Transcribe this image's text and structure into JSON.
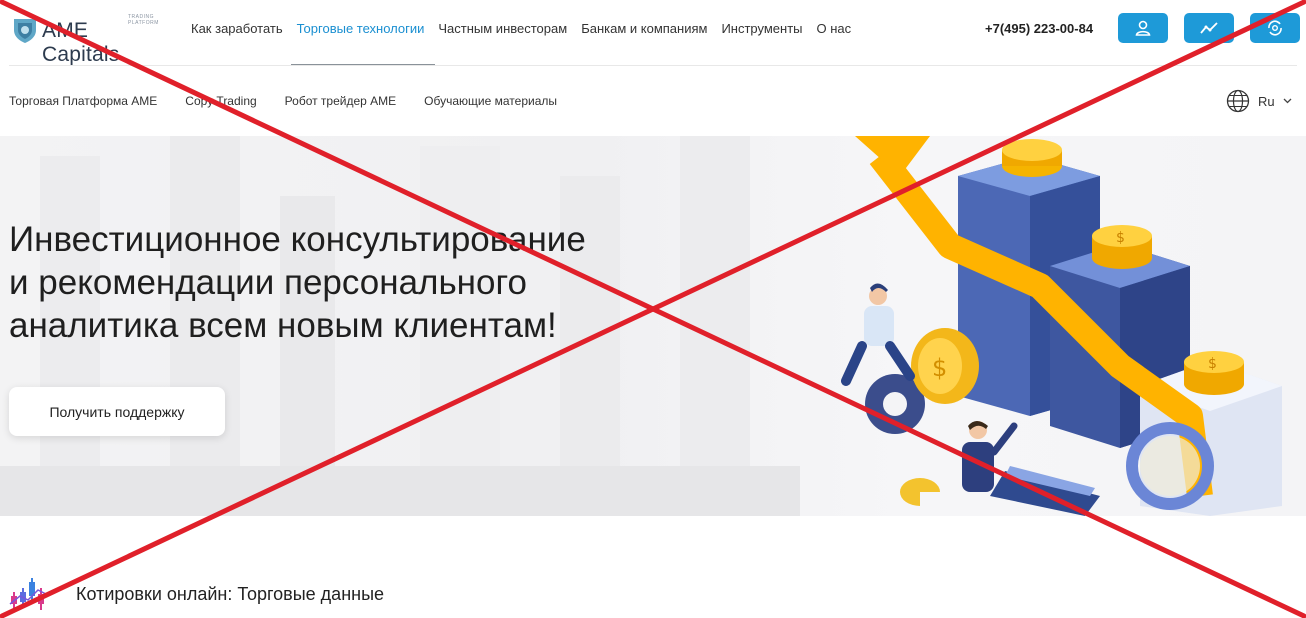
{
  "header": {
    "logo_text": "AME Capitals",
    "logo_subtitle": "TRADING PLATFORM",
    "nav": [
      {
        "label": "Как заработать"
      },
      {
        "label": "Торговые технологии",
        "active": true
      },
      {
        "label": "Частным инвесторам"
      },
      {
        "label": "Банкам и компаниям"
      },
      {
        "label": "Инструменты"
      },
      {
        "label": "О нас"
      }
    ],
    "phone": "+7(495) 223-00-84",
    "buttons": [
      {
        "icon": "user-icon"
      },
      {
        "icon": "trend-chart-icon"
      },
      {
        "icon": "currency-exchange-icon"
      }
    ],
    "accent_color": "#1e9ad8"
  },
  "subnav": {
    "items": [
      {
        "label": "Торговая Платформа AME"
      },
      {
        "label": "Copy Trading"
      },
      {
        "label": "Робот трейдер AME"
      },
      {
        "label": "Обучающие материалы"
      }
    ],
    "language": "Ru",
    "language_icon": "globe-icon"
  },
  "hero": {
    "title_lines": [
      "Инвестиционное консультирование",
      "и рекомендации персонального",
      "аналитика всем новым клиентам!"
    ],
    "cta_label": "Получить поддержку"
  },
  "quotes": {
    "title": "Котировки онлайн: Торговые данные",
    "icon": "candlestick-chart-icon"
  },
  "overlay": {
    "type": "red-cross",
    "color": "#e0202a"
  }
}
